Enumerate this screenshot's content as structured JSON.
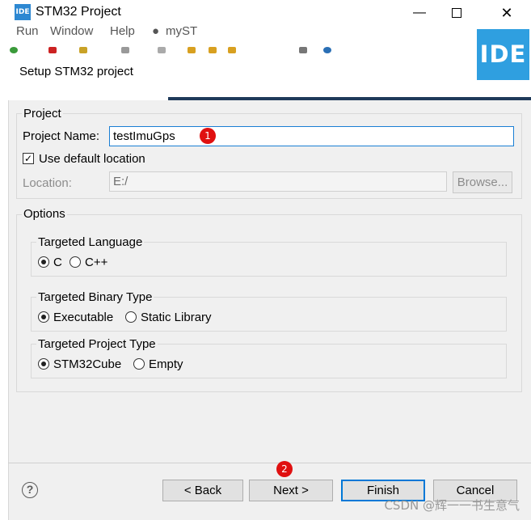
{
  "window": {
    "title": "STM32 Project",
    "app_icon_text": "IDE"
  },
  "menu": [
    "Run",
    "Window",
    "Help",
    "myST"
  ],
  "logo_text": "IDE",
  "wizard": {
    "header": "Setup STM32 project"
  },
  "project_group": {
    "label": "Project",
    "name_label": "Project Name:",
    "name_value": "testImuGps",
    "use_default_label": "Use default location",
    "use_default_checked": true,
    "location_label": "Location:",
    "location_value": "E:/",
    "browse_label": "Browse..."
  },
  "options_group": {
    "label": "Options",
    "language": {
      "label": "Targeted Language",
      "options": [
        "C",
        "C++"
      ],
      "selected": "C"
    },
    "binary": {
      "label": "Targeted Binary Type",
      "options": [
        "Executable",
        "Static Library"
      ],
      "selected": "Executable"
    },
    "project": {
      "label": "Targeted Project Type",
      "options": [
        "STM32Cube",
        "Empty"
      ],
      "selected": "STM32Cube"
    }
  },
  "buttons": {
    "back": "< Back",
    "next": "Next >",
    "finish": "Finish",
    "cancel": "Cancel"
  },
  "annotations": {
    "badge1": "1",
    "badge2": "2"
  },
  "watermark": "CSDN @辉一一书生意气",
  "colors": {
    "accent": "#0078d7",
    "logo_bg": "#2f9fe0",
    "badge": "#e01010"
  }
}
